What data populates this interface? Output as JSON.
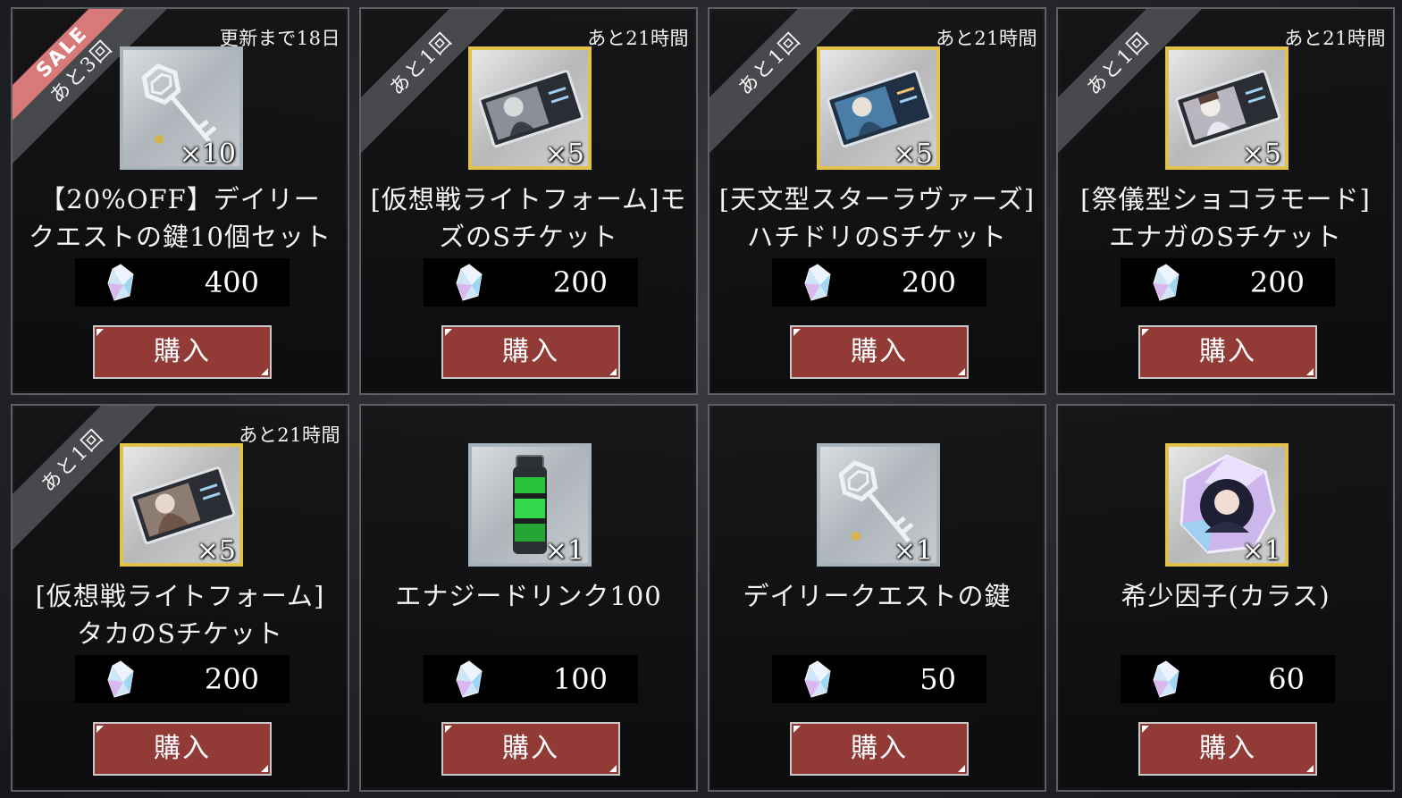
{
  "colors": {
    "buy_button": "#923a36",
    "sale_ribbon": "#d97a7a",
    "ribbon": "#48494d",
    "gold_frame": "#e3c24a",
    "silver_frame": "#a8b3bb"
  },
  "items": [
    {
      "ribbon_sale": "SALE",
      "ribbon": "あと3回",
      "timer": "更新まで18日",
      "icon": "daily-quest-key-icon",
      "frame": "silver",
      "qty": "×10",
      "name_line1": "【20%OFF】デイリー",
      "name_line2": "クエストの鍵10個セット",
      "price": "400",
      "buy": "購入"
    },
    {
      "ribbon_sale": "",
      "ribbon": "あと1回",
      "timer": "あと21時間",
      "icon": "s-ticket-icon",
      "frame": "gold",
      "qty": "×5",
      "name_line1": "[仮想戦ライトフォーム]モ",
      "name_line2": "ズのSチケット",
      "price": "200",
      "buy": "購入"
    },
    {
      "ribbon_sale": "",
      "ribbon": "あと1回",
      "timer": "あと21時間",
      "icon": "s-ticket-icon",
      "frame": "gold",
      "qty": "×5",
      "name_line1": "[天文型スターラヴァーズ]",
      "name_line2": "ハチドリのSチケット",
      "price": "200",
      "buy": "購入"
    },
    {
      "ribbon_sale": "",
      "ribbon": "あと1回",
      "timer": "あと21時間",
      "icon": "s-ticket-icon",
      "frame": "gold",
      "qty": "×5",
      "name_line1": "[祭儀型ショコラモード]",
      "name_line2": "エナガのSチケット",
      "price": "200",
      "buy": "購入"
    },
    {
      "ribbon_sale": "",
      "ribbon": "あと1回",
      "timer": "あと21時間",
      "icon": "s-ticket-icon",
      "frame": "gold",
      "qty": "×5",
      "name_line1": "[仮想戦ライトフォーム]",
      "name_line2": "タカのSチケット",
      "price": "200",
      "buy": "購入"
    },
    {
      "ribbon_sale": "",
      "ribbon": "",
      "timer": "",
      "icon": "energy-drink-icon",
      "frame": "silver",
      "qty": "×1",
      "name_line1": "エナジードリンク100",
      "name_line2": "",
      "price": "100",
      "buy": "購入"
    },
    {
      "ribbon_sale": "",
      "ribbon": "",
      "timer": "",
      "icon": "daily-quest-key-icon",
      "frame": "silver",
      "qty": "×1",
      "name_line1": "デイリークエストの鍵",
      "name_line2": "",
      "price": "50",
      "buy": "購入"
    },
    {
      "ribbon_sale": "",
      "ribbon": "",
      "timer": "",
      "icon": "rare-factor-icon",
      "frame": "gold",
      "qty": "×1",
      "name_line1": "希少因子(カラス)",
      "name_line2": "",
      "price": "60",
      "buy": "購入"
    }
  ]
}
